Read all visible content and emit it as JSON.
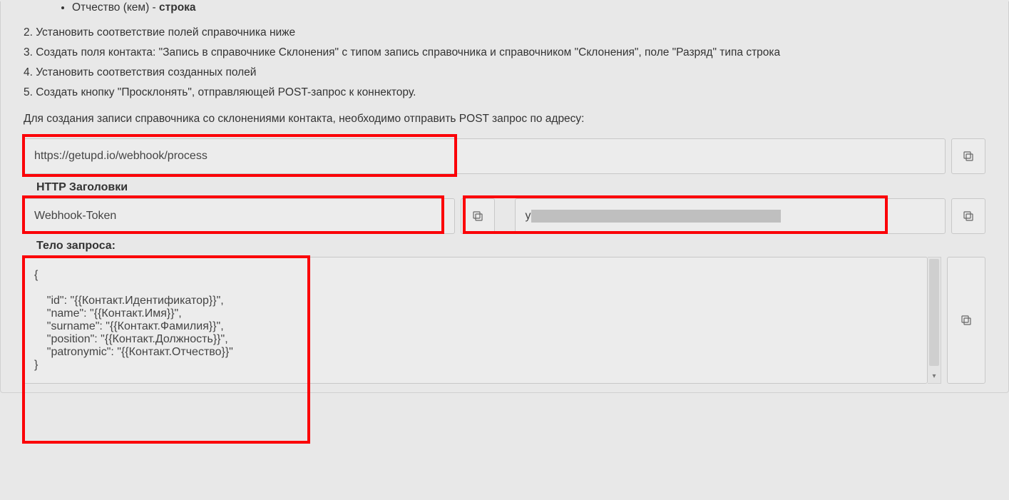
{
  "bullet": {
    "text": "Отчество (кем) - ",
    "bold": "строка"
  },
  "steps": {
    "s2": "2. Установить соответствие полей справочника ниже",
    "s3": "3. Создать поля контакта: \"Запись в справочнике Склонения\" с типом запись справочника и справочником \"Склонения\", поле \"Разряд\" типа строка",
    "s4": "4. Установить соответствия созданных полей",
    "s5": "5. Создать кнопку \"Просклонять\", отправляющей POST-запрос к коннектору."
  },
  "para": "Для создания записи справочника со склонениями контакта, необходимо отправить POST запрос по адресу:",
  "url": "https://getupd.io/webhook/process",
  "headers": {
    "label": "HTTP Заголовки",
    "name": "Webhook-Token",
    "value_prefix": "y"
  },
  "body": {
    "label": "Тело запроса:",
    "text": "{\n\n    \"id\": \"{{Контакт.Идентификатор}}\",\n    \"name\": \"{{Контакт.Имя}}\",\n    \"surname\": \"{{Контакт.Фамилия}}\",\n    \"position\": \"{{Контакт.Должность}}\",\n    \"patronymic\": \"{{Контакт.Отчество}}\"\n}"
  }
}
